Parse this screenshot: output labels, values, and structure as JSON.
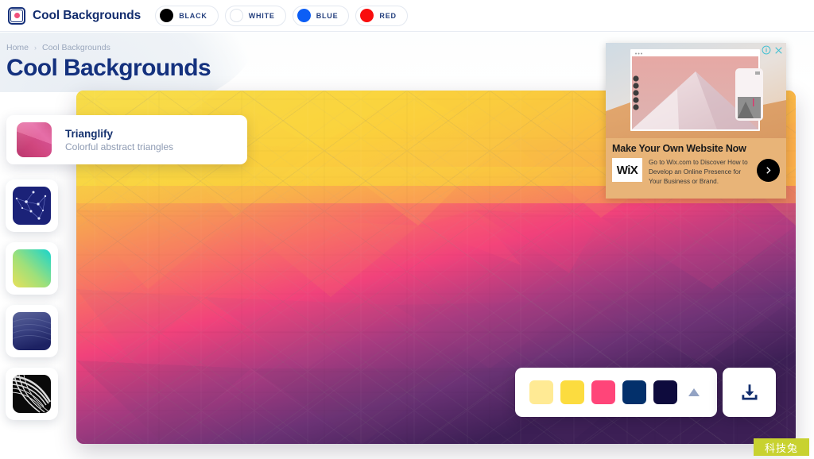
{
  "header": {
    "brand_name": "Cool Backgrounds",
    "logo_icon": "app-logo-icon",
    "color_filters": [
      {
        "label": "BLACK",
        "color": "#000000"
      },
      {
        "label": "WHITE",
        "color": "#ffffff"
      },
      {
        "label": "BLUE",
        "color": "#0c5ef5"
      },
      {
        "label": "RED",
        "color": "#f90d0d"
      }
    ]
  },
  "breadcrumb": {
    "home": "Home",
    "separator": "›",
    "current": "Cool Backgrounds"
  },
  "page": {
    "title": "Cool Backgrounds"
  },
  "sidebar": {
    "active": {
      "title": "Trianglify",
      "description": "Colorful abstract triangles",
      "thumb_icon": "trianglify-thumbnail"
    },
    "items": [
      {
        "name": "topography-network",
        "thumb_icon": "constellation-thumbnail"
      },
      {
        "name": "gradient-yellow-teal",
        "thumb_icon": "gradient-thumbnail"
      },
      {
        "name": "fluid-navy",
        "thumb_icon": "fluid-thumbnail"
      },
      {
        "name": "swirl-monochrome",
        "thumb_icon": "swirl-thumbnail"
      }
    ]
  },
  "preview": {
    "generator": "Trianglify",
    "palette": [
      {
        "hex": "#ffea94",
        "name": "pale-yellow"
      },
      {
        "hex": "#fcdc3f",
        "name": "golden-yellow"
      },
      {
        "hex": "#ff4579",
        "name": "pink"
      },
      {
        "hex": "#03306b",
        "name": "navy"
      },
      {
        "hex": "#0e0b3d",
        "name": "dark-navy"
      }
    ],
    "expand_icon": "caret-up-icon",
    "download_icon": "download-icon"
  },
  "ad": {
    "headline": "Make Your Own Website Now",
    "brand": "WiX",
    "body": "Go to Wix.com to Discover How to Develop an Online Presence for Your Business or Brand.",
    "cta_icon": "chevron-right-icon",
    "info_icon": "ad-info-icon",
    "close_icon": "ad-close-icon",
    "accent": "#e8b478"
  },
  "watermark": {
    "text": "科技兔",
    "color": "#c8d230"
  }
}
